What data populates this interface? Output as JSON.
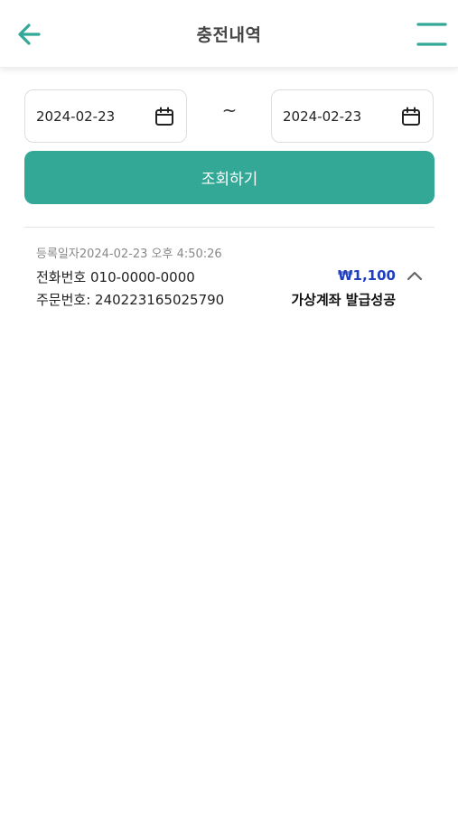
{
  "header": {
    "title": "충전내역",
    "back_icon": "arrow-left-icon",
    "menu_icon": "menu-icon",
    "accent_color": "#33a896"
  },
  "filter": {
    "start_date": "2024-02-23",
    "end_date": "2024-02-23",
    "separator": "~",
    "calendar_icon": "calendar-icon",
    "search_label": "조회하기",
    "button_color": "#33a896"
  },
  "records": [
    {
      "registered_label": "등록일자",
      "registered_at": "2024-02-23 오후 4:50:26",
      "phone_label": "전화번호",
      "phone": "010-0000-0000",
      "order_label": "주문번호:",
      "order_no": "240223165025790",
      "amount": "₩1,100",
      "amount_color": "#1f3fbf",
      "status": "가상계좌 발급성공",
      "toggle_icon": "chevron-up-icon"
    }
  ]
}
